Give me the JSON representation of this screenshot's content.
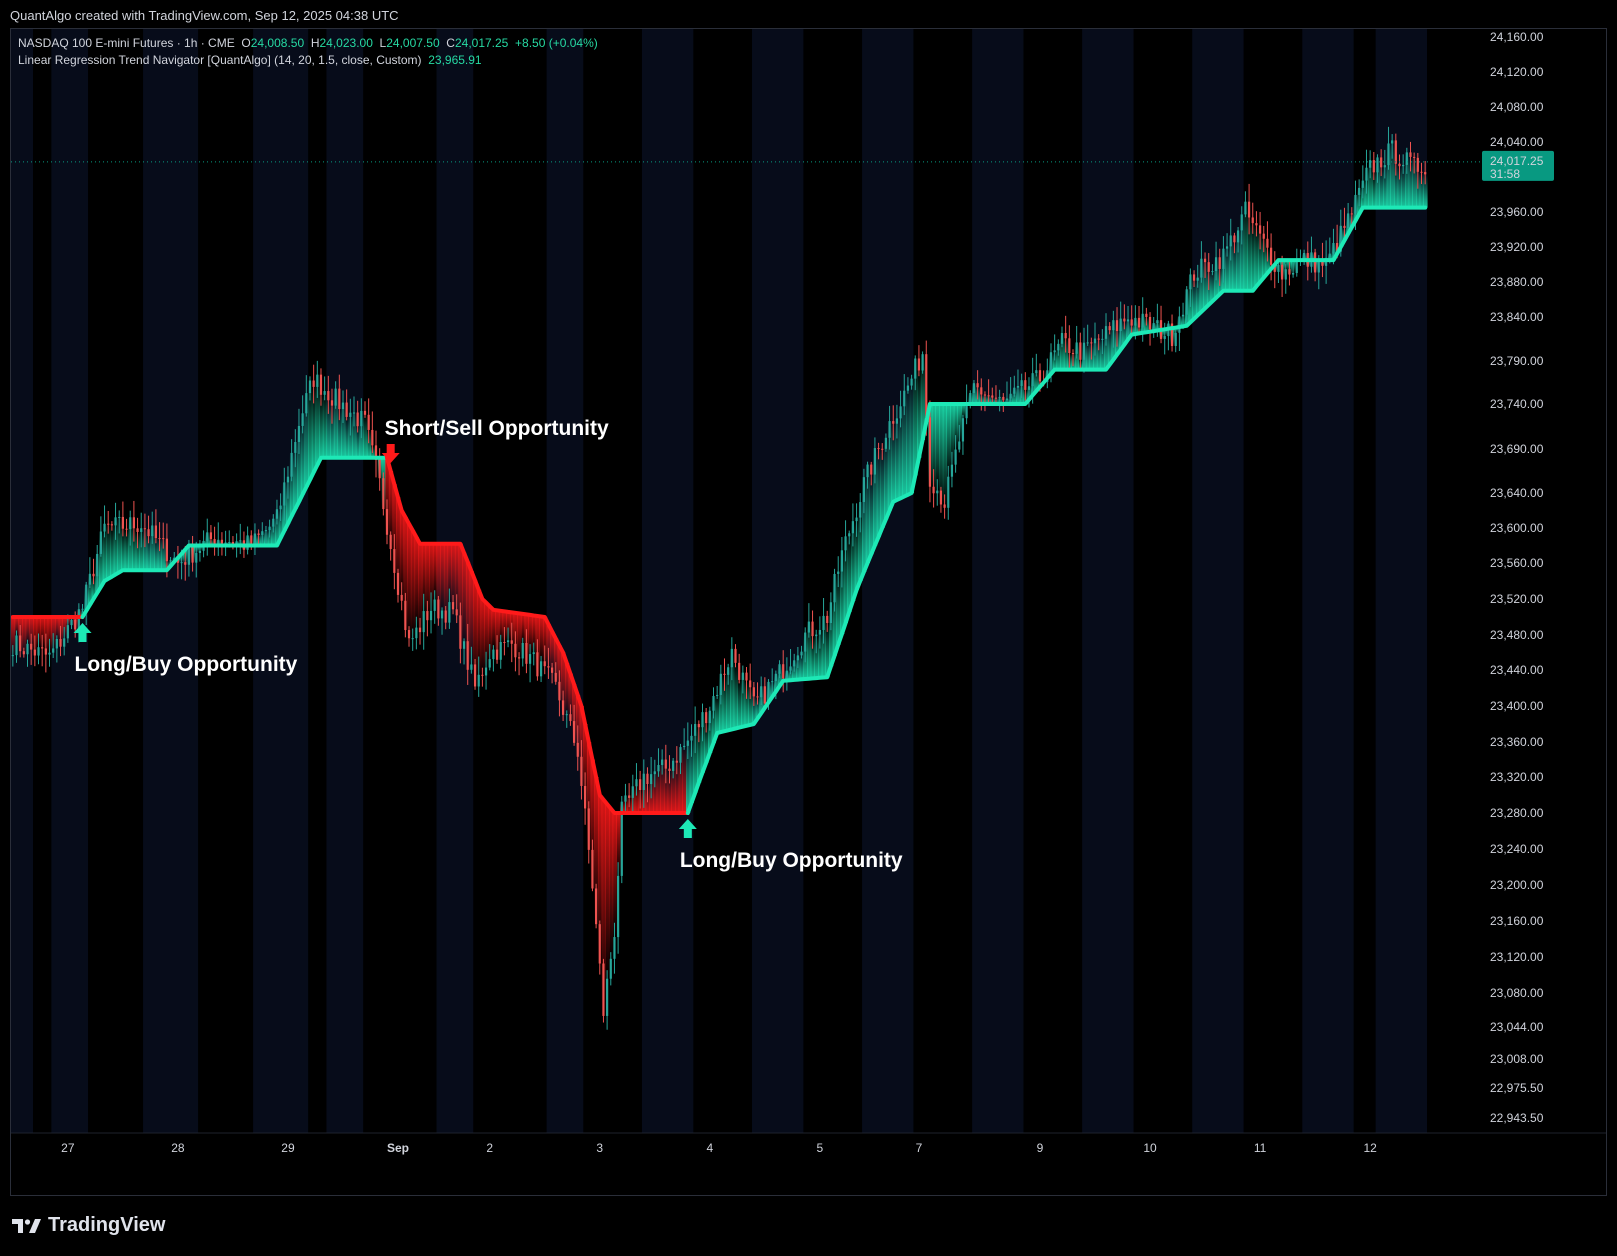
{
  "credit": "QuantAlgo created with TradingView.com, Sep 12, 2025 04:38 UTC",
  "legend": {
    "symbol": "NASDAQ 100 E-mini Futures · 1h · CME",
    "o_label": "O",
    "o_value": "24,008.50",
    "h_label": "H",
    "h_value": "24,023.00",
    "l_label": "L",
    "l_value": "24,007.50",
    "c_label": "C",
    "c_value": "24,017.25",
    "change": "+8.50 (+0.04%)",
    "indicator": "Linear Regression Trend Navigator [QuantAlgo] (14, 20, 1.5, close, Custom)",
    "indicator_value": "23,965.91"
  },
  "footer": {
    "brand": "TradingView"
  },
  "colors": {
    "bull": "#1de9b6",
    "bear": "#ff1a1a",
    "up_candle": "#26a69a",
    "down_candle": "#ef5350",
    "session_band": "#070c1a",
    "background": "#000000",
    "price_tag": "#089981"
  },
  "chart_data": {
    "type": "candlestick",
    "y_ticks": [
      "24,160.00",
      "24,120.00",
      "24,080.00",
      "24,040.00",
      "23,960.00",
      "23,920.00",
      "23,880.00",
      "23,840.00",
      "23,790.00",
      "23,740.00",
      "23,690.00",
      "23,640.00",
      "23,600.00",
      "23,560.00",
      "23,520.00",
      "23,480.00",
      "23,440.00",
      "23,400.00",
      "23,360.00",
      "23,320.00",
      "23,280.00",
      "23,240.00",
      "23,200.00",
      "23,160.00",
      "23,120.00",
      "23,080.00",
      "23,044.00",
      "23,008.00",
      "22,975.50",
      "22,943.50"
    ],
    "y_tick_values": [
      24160,
      24120,
      24080,
      24040,
      23960,
      23920,
      23880,
      23840,
      23790,
      23740,
      23690,
      23640,
      23600,
      23560,
      23520,
      23480,
      23440,
      23400,
      23360,
      23320,
      23280,
      23240,
      23200,
      23160,
      23120,
      23080,
      23044,
      23008,
      22975.5,
      22943.5
    ],
    "x_ticks": [
      "27",
      "28",
      "29",
      "Sep",
      "2",
      "3",
      "4",
      "5",
      "7",
      "9",
      "10",
      "11",
      "12"
    ],
    "x_tick_bars": [
      15,
      45,
      75,
      105,
      130,
      160,
      190,
      220,
      247,
      280,
      310,
      340,
      370
    ],
    "n_bars": 386,
    "last_price": "24,017.25",
    "countdown": "31:58",
    "last_value": 24017.25,
    "trend_segments": [
      {
        "trend": "bear",
        "start_bar": 0,
        "end_bar": 19
      },
      {
        "trend": "bull",
        "start_bar": 19,
        "end_bar": 102
      },
      {
        "trend": "bear",
        "start_bar": 102,
        "end_bar": 184
      },
      {
        "trend": "bull",
        "start_bar": 184,
        "end_bar": 386
      }
    ],
    "trend_anchors": [
      [
        0,
        23500
      ],
      [
        19,
        23500
      ],
      [
        25,
        23540
      ],
      [
        30,
        23552
      ],
      [
        42,
        23552
      ],
      [
        48,
        23580
      ],
      [
        72,
        23580
      ],
      [
        84,
        23680
      ],
      [
        95,
        23680
      ],
      [
        102,
        23680
      ],
      [
        106,
        23620
      ],
      [
        111,
        23582
      ],
      [
        122,
        23582
      ],
      [
        128,
        23520
      ],
      [
        131,
        23508
      ],
      [
        145,
        23500
      ],
      [
        150,
        23460
      ],
      [
        155,
        23400
      ],
      [
        160,
        23300
      ],
      [
        164,
        23280
      ],
      [
        184,
        23280
      ],
      [
        192,
        23370
      ],
      [
        202,
        23380
      ],
      [
        210,
        23428
      ],
      [
        222,
        23432
      ],
      [
        230,
        23530
      ],
      [
        240,
        23630
      ],
      [
        245,
        23640
      ],
      [
        250,
        23740
      ],
      [
        276,
        23740
      ],
      [
        284,
        23780
      ],
      [
        298,
        23780
      ],
      [
        305,
        23820
      ],
      [
        320,
        23830
      ],
      [
        330,
        23870
      ],
      [
        338,
        23870
      ],
      [
        345,
        23905
      ],
      [
        360,
        23905
      ],
      [
        368,
        23965
      ],
      [
        386,
        23965
      ]
    ],
    "price_anchors": [
      [
        0,
        23470
      ],
      [
        10,
        23455
      ],
      [
        19,
        23510
      ],
      [
        25,
        23600
      ],
      [
        35,
        23605
      ],
      [
        45,
        23560
      ],
      [
        55,
        23590
      ],
      [
        65,
        23580
      ],
      [
        72,
        23610
      ],
      [
        78,
        23720
      ],
      [
        82,
        23770
      ],
      [
        88,
        23745
      ],
      [
        96,
        23718
      ],
      [
        100,
        23650
      ],
      [
        104,
        23560
      ],
      [
        108,
        23470
      ],
      [
        114,
        23510
      ],
      [
        120,
        23505
      ],
      [
        126,
        23420
      ],
      [
        130,
        23460
      ],
      [
        136,
        23470
      ],
      [
        142,
        23450
      ],
      [
        148,
        23420
      ],
      [
        154,
        23350
      ],
      [
        158,
        23200
      ],
      [
        161,
        23060
      ],
      [
        164,
        23150
      ],
      [
        166,
        23280
      ],
      [
        172,
        23320
      ],
      [
        178,
        23330
      ],
      [
        184,
        23360
      ],
      [
        190,
        23400
      ],
      [
        196,
        23460
      ],
      [
        202,
        23400
      ],
      [
        208,
        23430
      ],
      [
        216,
        23480
      ],
      [
        222,
        23500
      ],
      [
        226,
        23570
      ],
      [
        232,
        23650
      ],
      [
        238,
        23710
      ],
      [
        244,
        23760
      ],
      [
        248,
        23800
      ],
      [
        250,
        23660
      ],
      [
        254,
        23630
      ],
      [
        258,
        23700
      ],
      [
        262,
        23760
      ],
      [
        270,
        23740
      ],
      [
        280,
        23770
      ],
      [
        286,
        23810
      ],
      [
        292,
        23800
      ],
      [
        298,
        23820
      ],
      [
        304,
        23840
      ],
      [
        310,
        23830
      ],
      [
        316,
        23820
      ],
      [
        322,
        23890
      ],
      [
        330,
        23910
      ],
      [
        336,
        23960
      ],
      [
        340,
        23930
      ],
      [
        346,
        23890
      ],
      [
        352,
        23905
      ],
      [
        358,
        23900
      ],
      [
        364,
        23950
      ],
      [
        370,
        24010
      ],
      [
        376,
        24030
      ],
      [
        382,
        24010
      ],
      [
        386,
        24017
      ]
    ],
    "annotations": [
      {
        "text": "Long/Buy Opportunity",
        "bar": 19,
        "direction": "up"
      },
      {
        "text": "Short/Sell Opportunity",
        "bar": 103,
        "direction": "down"
      },
      {
        "text": "Long/Buy Opportunity",
        "bar": 184,
        "direction": "up"
      }
    ]
  }
}
